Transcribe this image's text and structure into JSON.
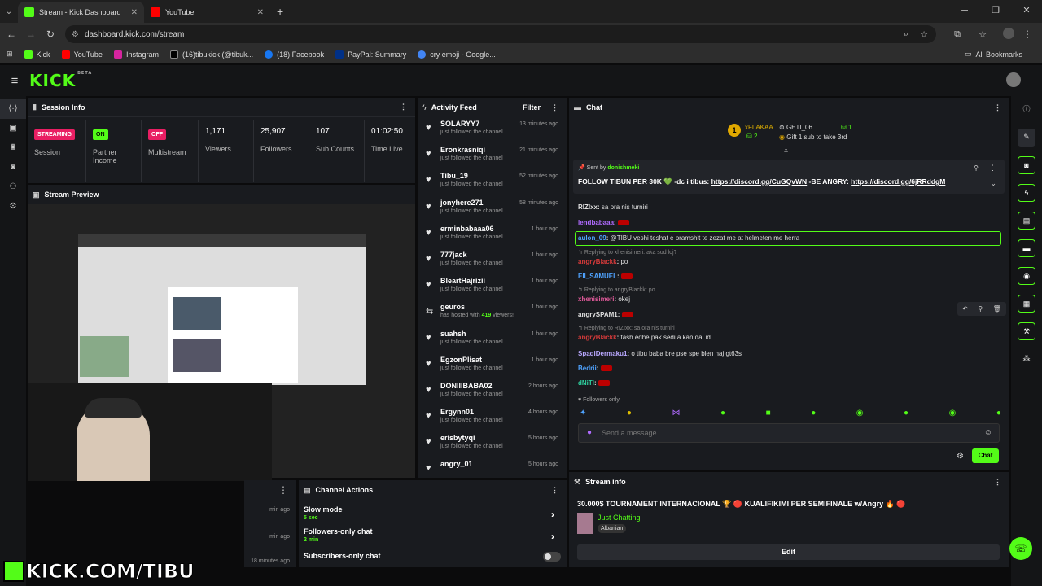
{
  "browser": {
    "tabs": [
      {
        "title": "Stream - Kick Dashboard",
        "color": "#53fc18"
      },
      {
        "title": "YouTube",
        "color": "#ff0000"
      }
    ],
    "url": "dashboard.kick.com/stream",
    "bookmarks": [
      {
        "label": "Kick",
        "color": "#53fc18"
      },
      {
        "label": "YouTube",
        "color": "#ff0000"
      },
      {
        "label": "Instagram",
        "color": "#d6249f"
      },
      {
        "label": "(16)tibukick (@tibuk...",
        "color": "#000000"
      },
      {
        "label": "(18) Facebook",
        "color": "#1877f2"
      },
      {
        "label": "PayPal: Summary",
        "color": "#003087"
      },
      {
        "label": "cry emoji - Google...",
        "color": "#4285f4"
      }
    ],
    "all_bookmarks": "All Bookmarks"
  },
  "header": {
    "logo": "KICK",
    "beta": "BETA"
  },
  "session": {
    "title": "Session Info",
    "items": [
      {
        "badge": "STREAMING",
        "label": "Session",
        "badge_color": "#e91e63"
      },
      {
        "badge": "ON",
        "label": "Partner Income",
        "badge_color": "#53fc18"
      },
      {
        "badge": "OFF",
        "label": "Multistream",
        "badge_color": "#e91e63"
      }
    ],
    "stats": [
      {
        "value": "1,171",
        "label": "Viewers"
      },
      {
        "value": "25,907",
        "label": "Followers"
      },
      {
        "value": "107",
        "label": "Sub Counts"
      },
      {
        "value": "01:02:50",
        "label": "Time Live"
      }
    ]
  },
  "preview": {
    "title": "Stream Preview"
  },
  "activity": {
    "title": "Activity Feed",
    "filter": "Filter",
    "items": [
      {
        "name": "SOLARYY7",
        "sub": "just followed the channel",
        "time": "13 minutes ago"
      },
      {
        "name": "Eronkrasniqi",
        "sub": "just followed the channel",
        "time": "21 minutes ago"
      },
      {
        "name": "Tibu_19",
        "sub": "just followed the channel",
        "time": "52 minutes ago"
      },
      {
        "name": "jonyhere271",
        "sub": "just followed the channel",
        "time": "58 minutes ago"
      },
      {
        "name": "erminbabaaa06",
        "sub": "just followed the channel",
        "time": "1 hour ago"
      },
      {
        "name": "777jack",
        "sub": "just followed the channel",
        "time": "1 hour ago"
      },
      {
        "name": "BleartHajrizii",
        "sub": "just followed the channel",
        "time": "1 hour ago"
      },
      {
        "name": "geuros",
        "sub": "has hosted with",
        "sub_hl": "419",
        "sub_end": "viewers!",
        "time": "1 hour ago"
      },
      {
        "name": "suahsh",
        "sub": "just followed the channel",
        "time": "1 hour ago"
      },
      {
        "name": "EgzonPlisat",
        "sub": "just followed the channel",
        "time": "1 hour ago"
      },
      {
        "name": "DONIIIBABA02",
        "sub": "just followed the channel",
        "time": "2 hours ago"
      },
      {
        "name": "Ergynn01",
        "sub": "just followed the channel",
        "time": "4 hours ago"
      },
      {
        "name": "erisbytyqi",
        "sub": "just followed the channel",
        "time": "5 hours ago"
      },
      {
        "name": "angry_01",
        "sub": "",
        "time": "5 hours ago"
      }
    ]
  },
  "chat": {
    "title": "Chat",
    "leader1": {
      "rank": "1",
      "name": "xFLAKAA",
      "count": "2"
    },
    "leader2": {
      "name": "GETI_06",
      "count": "1"
    },
    "gift_text": "Gift 1 sub to take 3rd",
    "pinned": {
      "sent_by": "Sent by",
      "sender": "donishmeki",
      "text": "FOLLOW TIBUN PER 30K 💚 -dc i tibus: ",
      "link1": "https://discord.gg/CuGQvWN",
      "mid": " -BE ANGRY: ",
      "link2": "https://discord.gg/6jRRddgM"
    },
    "messages": [
      {
        "user": "RIZIxx",
        "color": "#e0e0e0",
        "text": "sa ora nis turniri"
      },
      {
        "user": "lendbabaaa",
        "color": "#b06bff",
        "text": ""
      },
      {
        "user": "aulon_09",
        "color": "#4fa3ff",
        "text": "@TIBU veshi teshat e pramshit te zezat me at helmeten me herra"
      },
      {
        "reply": "Replying to xhenisimeri: aka sod loj?"
      },
      {
        "user": "angryBlackk",
        "color": "#d63a3a",
        "text": "po"
      },
      {
        "user": "Ell_SAMUEL",
        "color": "#4fa3ff",
        "text": ""
      },
      {
        "reply": "Replying to angryBlackk: po"
      },
      {
        "user": "xhenisimeri",
        "color": "#e05a9a",
        "text": "okej"
      },
      {
        "user": "angrySPAM1",
        "color": "#e0e0e0",
        "text": ""
      },
      {
        "reply": "Replying to RIZIxx: sa ora nis turniri"
      },
      {
        "user": "angryBlackk",
        "color": "#d63a3a",
        "text": "tash edhe pak sedi a kan dal id"
      },
      {
        "user": "SpaqiDermaku1",
        "color": "#b9a8ff",
        "text": "o tibu baba bre pse spe blen naj gt63s"
      },
      {
        "user": "Bedrii",
        "color": "#4fa3ff",
        "text": ""
      },
      {
        "user": "dNiTl",
        "color": "#2fd2a0",
        "text": ""
      }
    ],
    "followers_only": "Followers only",
    "placeholder": "Send a message",
    "send_label": "Chat"
  },
  "channel_actions": {
    "title": "Channel Actions",
    "items": [
      {
        "label": "Slow mode",
        "sub": "5 sec"
      },
      {
        "label": "Followers-only chat",
        "sub": "2 min"
      },
      {
        "label": "Subscribers-only chat",
        "sub": ""
      }
    ]
  },
  "recent_times": [
    "min ago",
    "min ago",
    "18 minutes ago"
  ],
  "stream_info": {
    "title": "Stream info",
    "stream_title": "30.000$ TOURNAMENT INTERNACIONAL 🏆 🔴 KUALIFIKIMI PER SEMIFINALE w/Angry 🔥 🔴",
    "category": "Just Chatting",
    "language": "Albanian",
    "edit": "Edit"
  },
  "overlay": {
    "watermark": "KICK.COM/TIBU"
  }
}
